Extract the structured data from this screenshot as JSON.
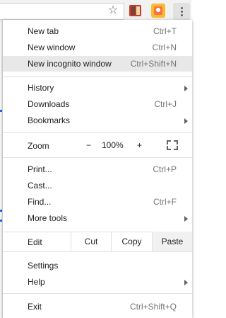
{
  "toolbar": {
    "icons": [
      "star-icon",
      "extension-icon-1",
      "extension-icon-2",
      "kebab-menu-icon"
    ]
  },
  "menu": {
    "new_tab": {
      "label": "New tab",
      "shortcut": "Ctrl+T"
    },
    "new_window": {
      "label": "New window",
      "shortcut": "Ctrl+N"
    },
    "new_incognito": {
      "label": "New incognito window",
      "shortcut": "Ctrl+Shift+N"
    },
    "history": {
      "label": "History"
    },
    "downloads": {
      "label": "Downloads",
      "shortcut": "Ctrl+J"
    },
    "bookmarks": {
      "label": "Bookmarks"
    },
    "zoom": {
      "label": "Zoom",
      "minus": "−",
      "value": "100%",
      "plus": "+"
    },
    "print": {
      "label": "Print...",
      "shortcut": "Ctrl+P"
    },
    "cast": {
      "label": "Cast..."
    },
    "find": {
      "label": "Find...",
      "shortcut": "Ctrl+F"
    },
    "more_tools": {
      "label": "More tools"
    },
    "edit": {
      "label": "Edit",
      "cut": "Cut",
      "copy": "Copy",
      "paste": "Paste"
    },
    "settings": {
      "label": "Settings"
    },
    "help": {
      "label": "Help"
    },
    "exit": {
      "label": "Exit",
      "shortcut": "Ctrl+Shift+Q"
    }
  },
  "colors": {
    "highlight": "#e8e8e8",
    "shortcut_text": "#757575",
    "separator": "#e0e0e0"
  }
}
